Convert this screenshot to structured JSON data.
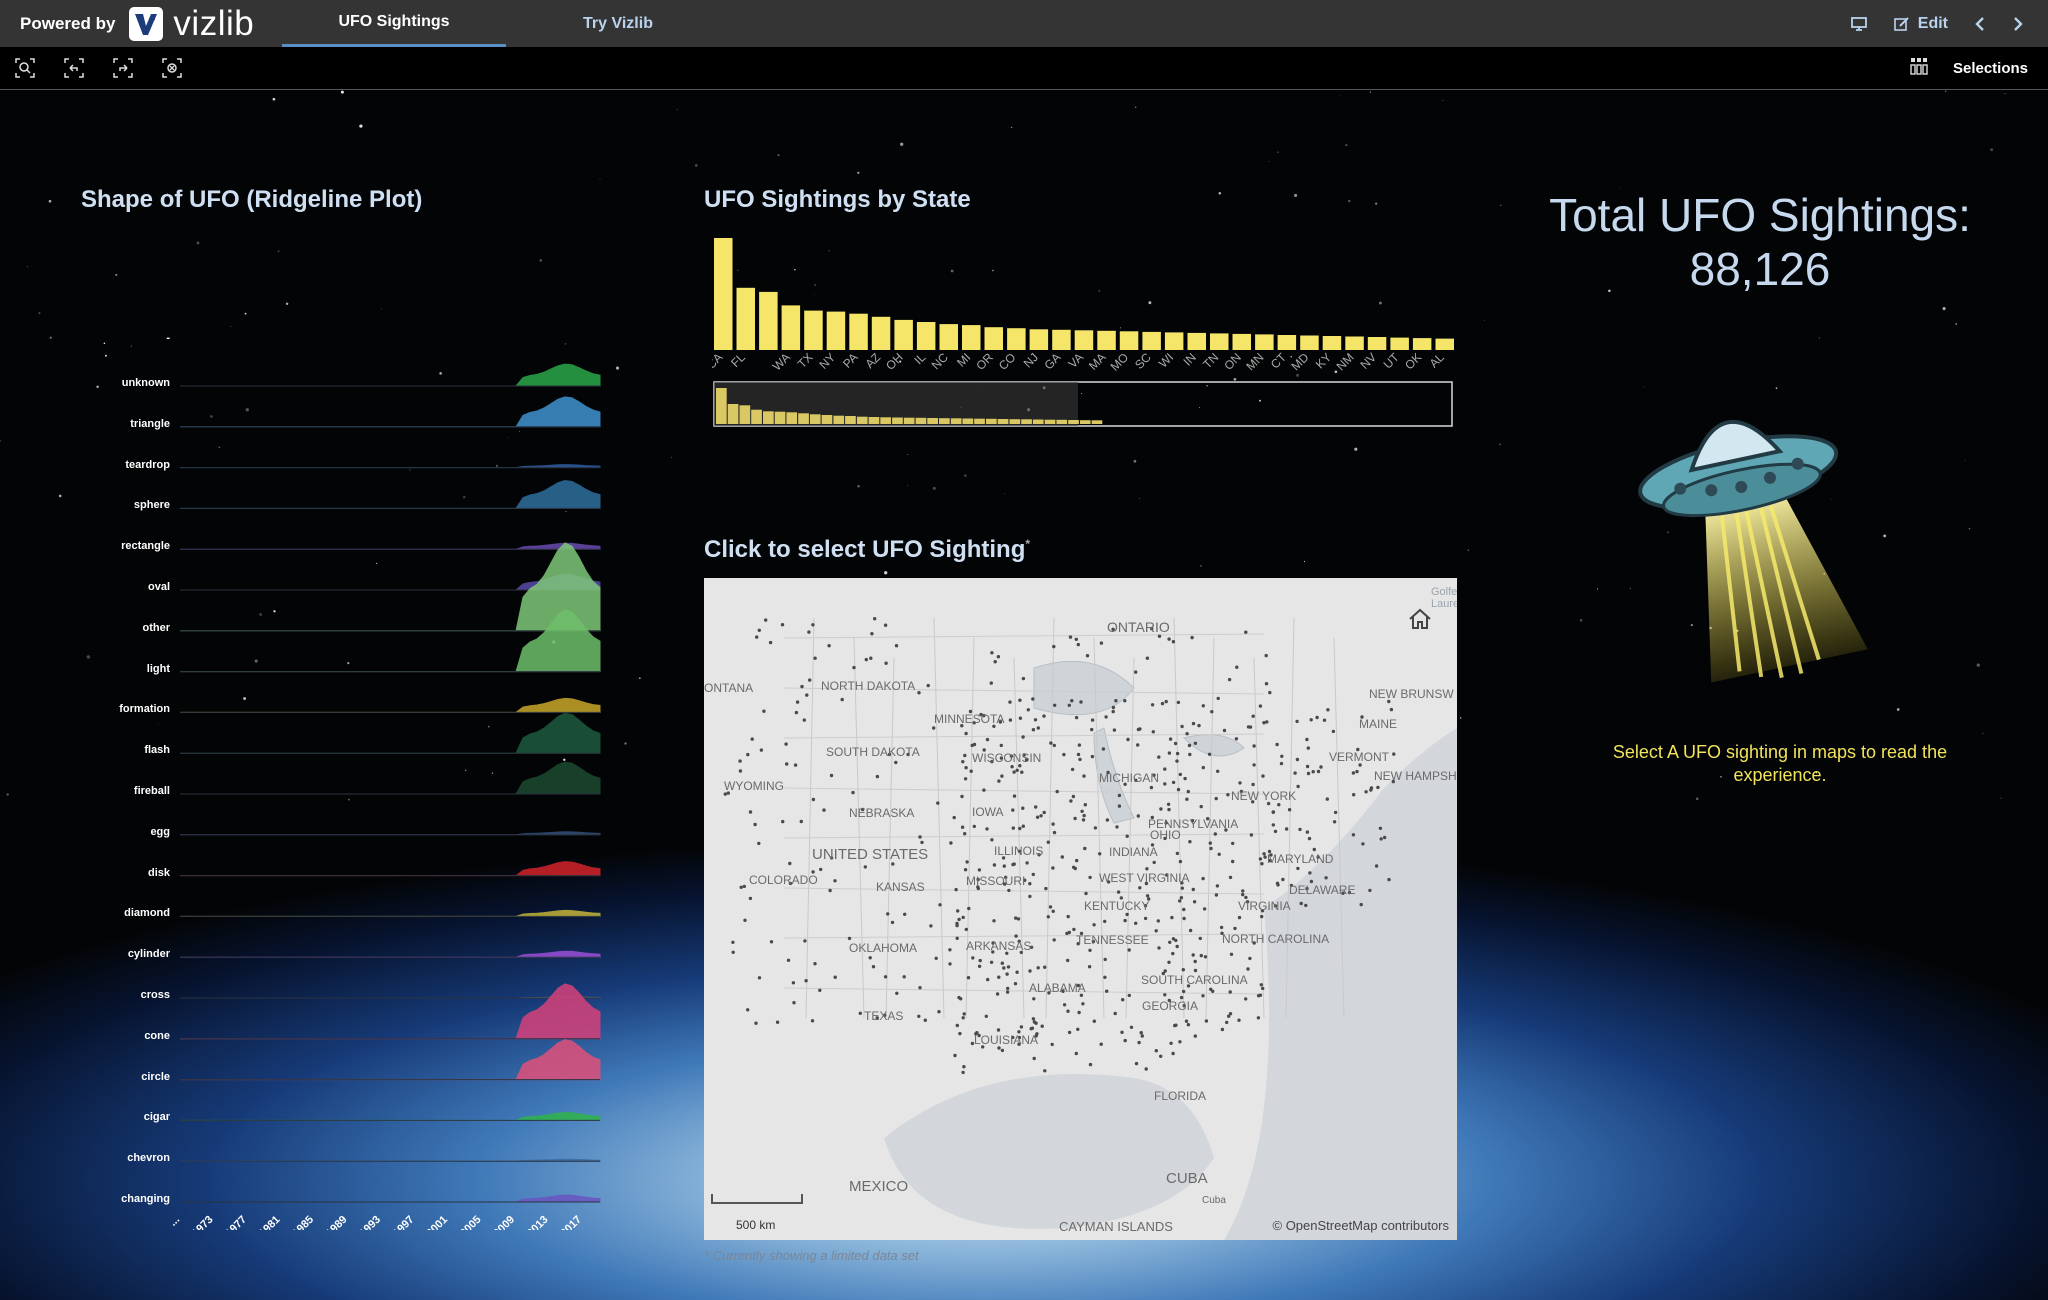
{
  "header": {
    "powered_by": "Powered by",
    "logo_text": "vizlib",
    "tabs": [
      {
        "label": "UFO Sightings",
        "active": true
      },
      {
        "label": "Try Vizlib",
        "active": false
      }
    ],
    "edit_label": "Edit"
  },
  "toolbar": {
    "tools": [
      "smart-search-icon",
      "undo-selection-icon",
      "redo-selection-icon",
      "clear-selections-icon"
    ],
    "selections_label": "Selections"
  },
  "ridgeline": {
    "title": "Shape of UFO (Ridgeline Plot)",
    "extra_label": "-",
    "shapes": [
      {
        "name": "unknown",
        "color": "#2aa84a"
      },
      {
        "name": "triangle",
        "color": "#3f93cf"
      },
      {
        "name": "teardrop",
        "color": "#2f5fa3"
      },
      {
        "name": "sphere",
        "color": "#2e6f9e"
      },
      {
        "name": "rectangle",
        "color": "#6a4bb0"
      },
      {
        "name": "oval",
        "color": "#5b4aa8"
      },
      {
        "name": "other",
        "color": "#7fc87a"
      },
      {
        "name": "light",
        "color": "#6fbf6a"
      },
      {
        "name": "formation",
        "color": "#c9a72a"
      },
      {
        "name": "flash",
        "color": "#1e5a3e"
      },
      {
        "name": "fireball",
        "color": "#1c4a30"
      },
      {
        "name": "egg",
        "color": "#34507a"
      },
      {
        "name": "disk",
        "color": "#d3242a"
      },
      {
        "name": "diamond",
        "color": "#c4b53a"
      },
      {
        "name": "cylinder",
        "color": "#9b4fd8"
      },
      {
        "name": "cross",
        "color": "#6b6b6b"
      },
      {
        "name": "cone",
        "color": "#d6417a"
      },
      {
        "name": "circle",
        "color": "#e0507a"
      },
      {
        "name": "cigar",
        "color": "#2fb34a"
      },
      {
        "name": "chevron",
        "color": "#3a6aa0"
      },
      {
        "name": "changing",
        "color": "#6a55c0"
      }
    ],
    "years": [
      "...",
      "1973",
      "1977",
      "1981",
      "1985",
      "1989",
      "1993",
      "1997",
      "2001",
      "2005",
      "2009",
      "2013",
      "2017"
    ]
  },
  "chart_data": {
    "type": "bar",
    "title": "UFO Sightings by State",
    "categories": [
      "CA",
      "FL",
      "",
      "WA",
      "TX",
      "NY",
      "PA",
      "AZ",
      "OH",
      "IL",
      "NC",
      "MI",
      "OR",
      "CO",
      "NJ",
      "GA",
      "VA",
      "MA",
      "MO",
      "SC",
      "WI",
      "IN",
      "TN",
      "ON",
      "MN",
      "CT",
      "MD",
      "KY",
      "NM",
      "NV",
      "UT",
      "OK",
      "AL"
    ],
    "values": [
      10800,
      6000,
      5600,
      4300,
      3800,
      3700,
      3500,
      3200,
      2900,
      2700,
      2500,
      2400,
      2200,
      2100,
      2000,
      1950,
      1900,
      1850,
      1800,
      1750,
      1700,
      1650,
      1600,
      1550,
      1500,
      1450,
      1400,
      1350,
      1300,
      1250,
      1200,
      1150,
      1100
    ],
    "bar_color": "#f5e66a",
    "grid": false,
    "legend": "none"
  },
  "total": {
    "label": "Total UFO Sightings:",
    "value": "88,126"
  },
  "map": {
    "title": "Click to select UFO Sighting",
    "title_marker": "*",
    "labels": [
      {
        "text": "ONTARIO",
        "kind": "region"
      },
      {
        "text": "NORTH DAKOTA",
        "kind": "state"
      },
      {
        "text": "ONTANA",
        "kind": "state"
      },
      {
        "text": "MINNESOTA",
        "kind": "state"
      },
      {
        "text": "SOUTH DAKOTA",
        "kind": "state"
      },
      {
        "text": "WYOMING",
        "kind": "state"
      },
      {
        "text": "WISCONSIN",
        "kind": "state"
      },
      {
        "text": "MICHIGAN",
        "kind": "state"
      },
      {
        "text": "NEBRASKA",
        "kind": "state"
      },
      {
        "text": "IOWA",
        "kind": "state"
      },
      {
        "text": "UNITED STATES",
        "kind": "country"
      },
      {
        "text": "ILLINOIS",
        "kind": "state"
      },
      {
        "text": "INDIANA",
        "kind": "state"
      },
      {
        "text": "OHIO",
        "kind": "state"
      },
      {
        "text": "PENNSYLVANIA",
        "kind": "state"
      },
      {
        "text": "NEW YORK",
        "kind": "state"
      },
      {
        "text": "VERMONT",
        "kind": "state"
      },
      {
        "text": "MAINE",
        "kind": "state"
      },
      {
        "text": "NEW BRUNSW",
        "kind": "region"
      },
      {
        "text": "NEW HAMPSHIRE",
        "kind": "state"
      },
      {
        "text": "COLORADO",
        "kind": "state"
      },
      {
        "text": "KANSAS",
        "kind": "state"
      },
      {
        "text": "MISSOURI",
        "kind": "state"
      },
      {
        "text": "WEST VIRGINIA",
        "kind": "state"
      },
      {
        "text": "KENTUCKY",
        "kind": "state"
      },
      {
        "text": "VIRGINIA",
        "kind": "state"
      },
      {
        "text": "DELAWARE",
        "kind": "state"
      },
      {
        "text": "MARYLAND",
        "kind": "state"
      },
      {
        "text": "OKLAHOMA",
        "kind": "state"
      },
      {
        "text": "ARKANSAS",
        "kind": "state"
      },
      {
        "text": "TENNESSEE",
        "kind": "state"
      },
      {
        "text": "NORTH CAROLINA",
        "kind": "state"
      },
      {
        "text": "SOUTH CAROLINA",
        "kind": "state"
      },
      {
        "text": "ALABAMA",
        "kind": "state"
      },
      {
        "text": "GEORGIA",
        "kind": "state"
      },
      {
        "text": "TEXAS",
        "kind": "state"
      },
      {
        "text": "LOUISIANA",
        "kind": "state"
      },
      {
        "text": "FLORIDA",
        "kind": "state"
      },
      {
        "text": "MEXICO",
        "kind": "country"
      },
      {
        "text": "CUBA",
        "kind": "country"
      },
      {
        "text": "Cuba",
        "kind": "region"
      },
      {
        "text": "CAYMAN ISLANDS",
        "kind": "country"
      },
      {
        "text": "Golfe",
        "kind": "water"
      },
      {
        "text": "Laure",
        "kind": "water"
      }
    ],
    "scale_label": "500 km",
    "attribution": "© OpenStreetMap contributors",
    "footnote": "* Currently showing a limited data set"
  },
  "ufo_panel": {
    "message": "Select A UFO sighting in maps to read the experience."
  }
}
